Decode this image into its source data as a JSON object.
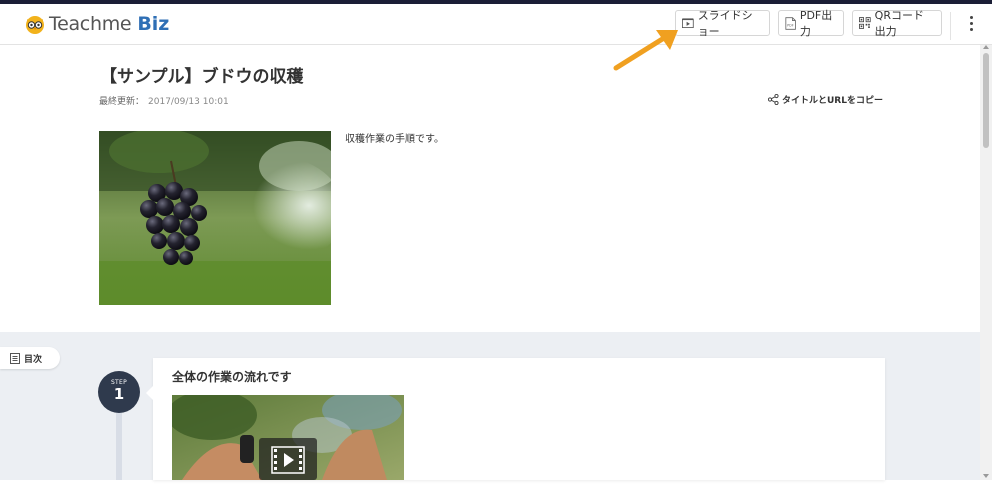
{
  "header": {
    "logo_teach": "Teach",
    "logo_me": "me",
    "logo_biz": "Biz",
    "slideshow_label": "スライドショー",
    "pdf_label": "PDF出力",
    "qr_label": "QRコード出力",
    "pdf_icon_text": "PDF"
  },
  "article": {
    "title": "【サンプル】ブドウの収穫",
    "updated_label": "最終更新：",
    "updated_date": "2017/09/13 10:01",
    "copy_label": "タイトルとURLをコピー",
    "description": "収穫作業の手順です。"
  },
  "toc": {
    "label": "目次"
  },
  "steps": [
    {
      "step_label": "STEP",
      "number": "1",
      "title": "全体の作業の流れです"
    }
  ],
  "colors": {
    "accent_arrow": "#f0a020",
    "brand_blue": "#2f6fb5",
    "step_circle": "#2f3a4d",
    "section_bg": "#eceff3"
  },
  "icons": {
    "slideshow": "slideshow-icon",
    "pdf": "pdf-file-icon",
    "qr": "qr-code-icon",
    "share": "share-icon",
    "toc": "list-icon",
    "play": "play-icon",
    "more": "kebab-menu-icon"
  }
}
